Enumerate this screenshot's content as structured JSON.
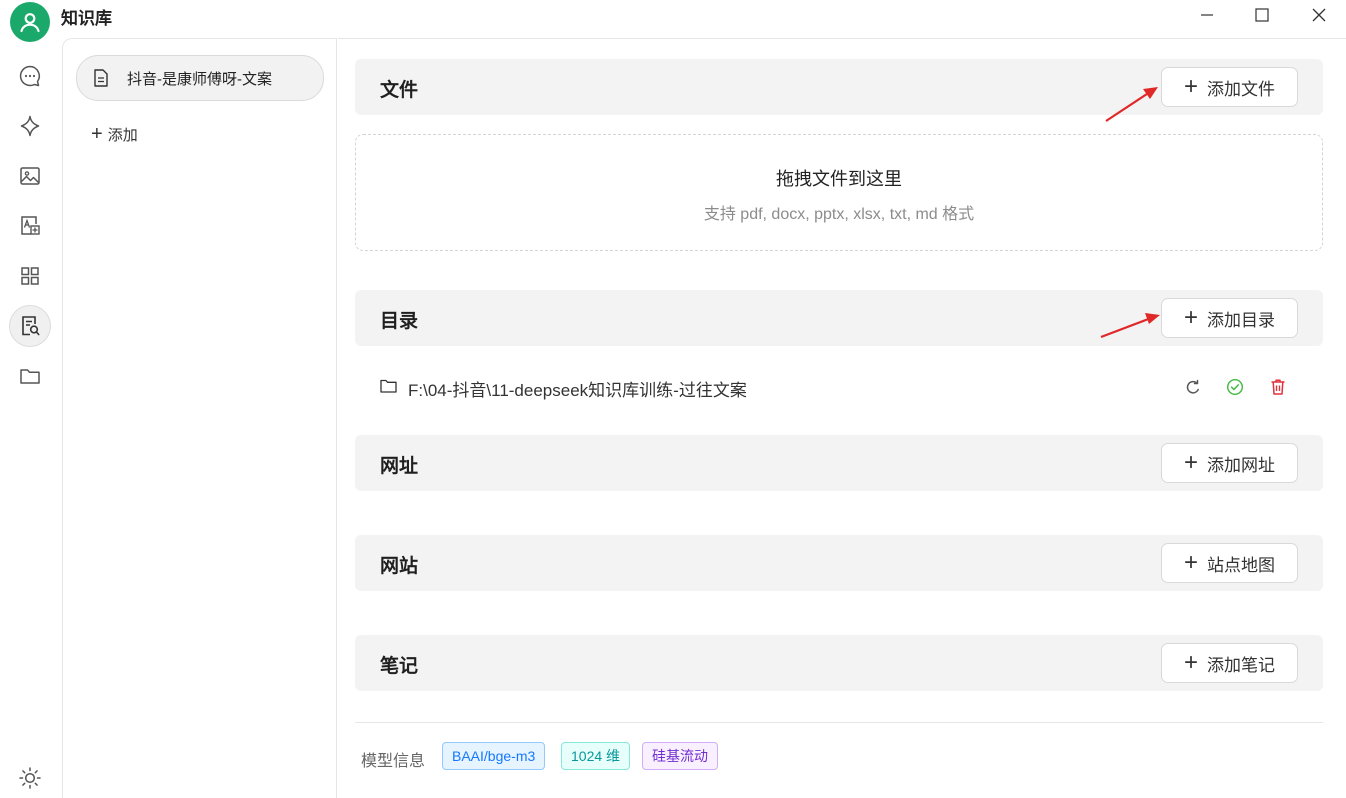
{
  "app": {
    "title": "知识库"
  },
  "colors": {
    "accent": "#1aa96a",
    "annotation_arrow": "#e02828",
    "danger": "#e0323a",
    "success": "#3fb93f"
  },
  "rail": {
    "icons": [
      "chat-icon",
      "sparkle-icon",
      "image-icon",
      "translate-icon",
      "apps-icon",
      "knowledge-icon",
      "folder-icon",
      "theme-sun-icon"
    ],
    "active": "knowledge-icon"
  },
  "sidebar": {
    "items": [
      {
        "label": "抖音-是康师傅呀-文案",
        "icon": "document-icon"
      }
    ],
    "add_label": "添加"
  },
  "main": {
    "file": {
      "title": "文件",
      "button": "添加文件"
    },
    "dropzone": {
      "title": "拖拽文件到这里",
      "subtitle": "支持 pdf, docx, pptx, xlsx, txt, md 格式"
    },
    "directory": {
      "title": "目录",
      "button": "添加目录",
      "items": [
        {
          "path": "F:\\04-抖音\\11-deepseek知识库训练-过往文案",
          "status": "success"
        }
      ]
    },
    "url": {
      "title": "网址",
      "button": "添加网址"
    },
    "website": {
      "title": "网站",
      "button": "站点地图"
    },
    "notes": {
      "title": "笔记",
      "button": "添加笔记"
    },
    "model_info": {
      "label": "模型信息",
      "tags": [
        {
          "text": "BAAI/bge-m3",
          "color": "#1677ff",
          "bg": "#e6f4ff",
          "border": "#91caff"
        },
        {
          "text": "1024 维",
          "color": "#08979c",
          "bg": "#e6fffb",
          "border": "#87e8de"
        },
        {
          "text": "硅基流动",
          "color": "#722ed1",
          "bg": "#f9f0ff",
          "border": "#d3adf7"
        }
      ]
    }
  }
}
